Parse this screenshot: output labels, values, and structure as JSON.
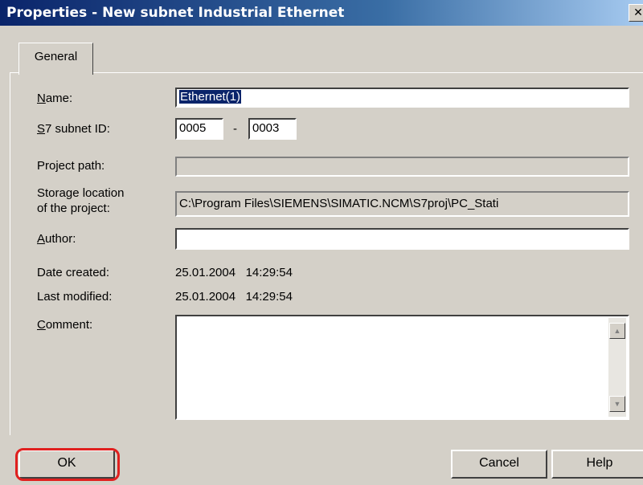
{
  "window": {
    "title": "Properties - New subnet Industrial Ethernet",
    "close_glyph": "✕"
  },
  "tabs": [
    {
      "label": "General",
      "selected": true
    }
  ],
  "form": {
    "name_label_u": "N",
    "name_label_rest": "ame:",
    "name_value": "Ethernet(1)",
    "subnet_label_u": "S",
    "subnet_label_rest": "7 subnet ID:",
    "subnet_id_part1": "0005",
    "subnet_id_sep": "-",
    "subnet_id_part2": "0003",
    "project_path_label": "Project path:",
    "project_path_value": "",
    "storage_label_line1": "Storage location",
    "storage_label_line2": "of the project:",
    "storage_value": "C:\\Program Files\\SIEMENS\\SIMATIC.NCM\\S7proj\\PC_Stati",
    "author_label_u": "A",
    "author_label_rest": "uthor:",
    "author_value": "",
    "date_created_label": "Date created:",
    "date_created_value": "25.01.2004   14:29:54",
    "last_modified_label": "Last modified:",
    "last_modified_value": "25.01.2004   14:29:54",
    "comment_label_u": "C",
    "comment_label_rest": "omment:",
    "comment_value": ""
  },
  "buttons": {
    "ok": "OK",
    "cancel": "Cancel",
    "help": "Help"
  },
  "icons": {
    "scroll_up": "▲",
    "scroll_down": "▼"
  },
  "colors": {
    "highlight_ring": "#e0201f",
    "title_bar": "#0a246a",
    "dialog_face": "#d4d0c8"
  }
}
